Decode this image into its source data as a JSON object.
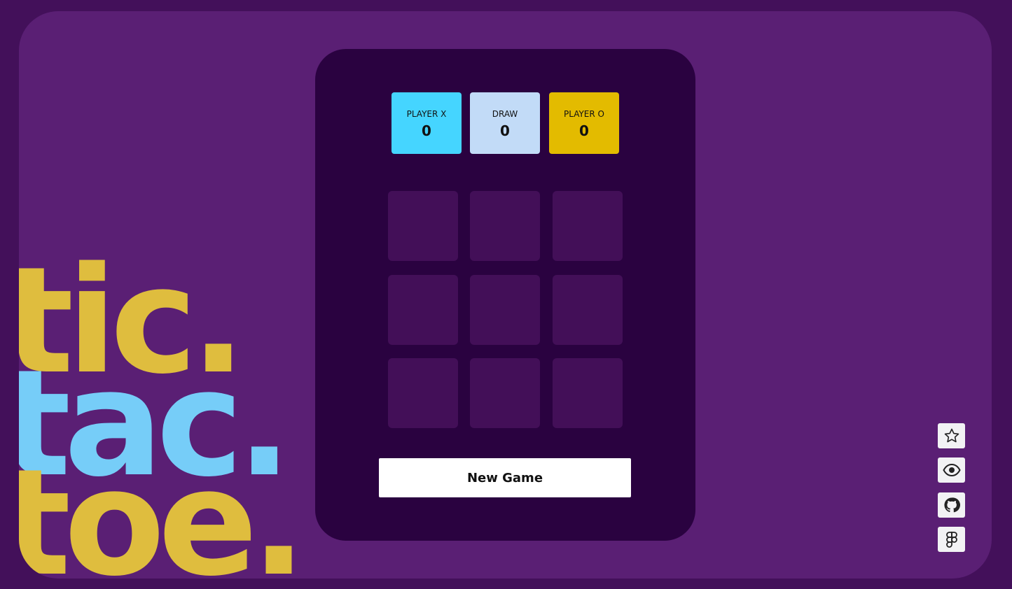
{
  "logo": {
    "line1": "tic.",
    "line2": "tac.",
    "line3": "toe."
  },
  "colors": {
    "background_outer": "#43105a",
    "background_frame": "#5a1f74",
    "board_panel": "#2a0240",
    "cell": "#430f58",
    "player_x": "#45d5ff",
    "draw": "#c2dbf7",
    "player_o": "#e3bb00",
    "logo_yellow": "#dfbd3e",
    "logo_blue": "#76cdf8"
  },
  "scoreboard": [
    {
      "label": "PLAYER X",
      "value": "0"
    },
    {
      "label": "DRAW",
      "value": "0"
    },
    {
      "label": "PLAYER O",
      "value": "0"
    }
  ],
  "board": {
    "cells": [
      "",
      "",
      "",
      "",
      "",
      "",
      "",
      "",
      ""
    ]
  },
  "controls": {
    "new_game_label": "New Game"
  },
  "side_actions": [
    {
      "icon": "star-icon"
    },
    {
      "icon": "eye-icon"
    },
    {
      "icon": "github-icon"
    },
    {
      "icon": "figma-icon"
    }
  ]
}
